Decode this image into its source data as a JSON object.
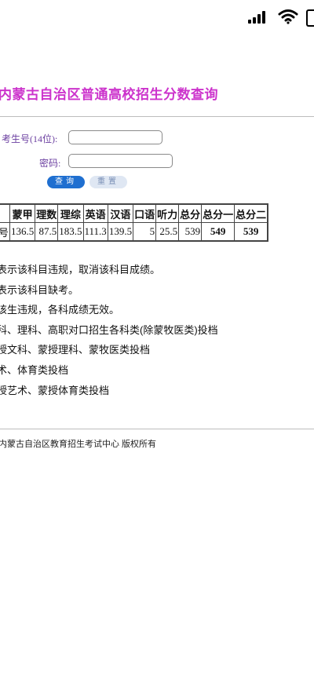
{
  "status_bar": {
    "icons": [
      "signal-icon",
      "wifi-icon",
      "battery-icon"
    ]
  },
  "page": {
    "title": "内蒙古自治区普通高校招生分数查询",
    "title_color": "#cc33cc"
  },
  "form": {
    "exam_id_label": "考生号(14位):",
    "exam_id_value": "",
    "password_label": "密码:",
    "password_value": "",
    "query_button": "查询",
    "reset_button": "重置",
    "query_color": "#1f6fd0"
  },
  "score_table": {
    "headers": [
      "",
      "蒙甲",
      "理数",
      "理综",
      "英语",
      "汉语",
      "口语",
      "听力",
      "总分",
      "总分一",
      "总分二"
    ],
    "row": [
      "号",
      "136.5",
      "87.5",
      "183.5",
      "111.3",
      "139.5",
      "5",
      "25.5",
      "539",
      "549",
      "539"
    ]
  },
  "notes": [
    "表示该科目违规，取消该科目成绩。",
    "表示该科目缺考。",
    "该生违规，各科成绩无效。",
    "科、理科、高职对口招生各科类(除蒙牧医类)投档",
    "授文科、蒙授理科、蒙牧医类投档",
    "术、体育类投档",
    "授艺术、蒙授体育类投档"
  ],
  "footer": {
    "copyright": "内蒙古自治区教育招生考试中心 版权所有"
  }
}
